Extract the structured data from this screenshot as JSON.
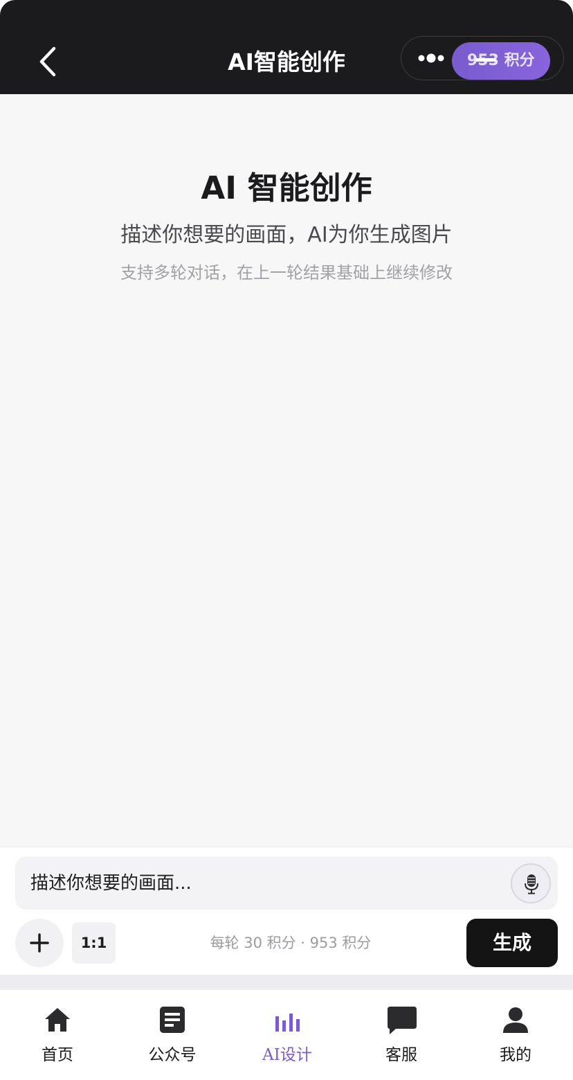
{
  "header": {
    "title": "AI智能创作",
    "credits_badge": "953 积分"
  },
  "hero": {
    "title": "AI 智能创作",
    "subtitle": "描述你想要的画面，AI为你生成图片",
    "hint": "支持多轮对话，在上一轮结果基础上继续修改"
  },
  "composer": {
    "placeholder": "描述你想要的画面...",
    "ratio_label": "1:1",
    "cost_info": "每轮 30 积分 · 953 积分",
    "generate_label": "生成"
  },
  "tabbar": {
    "items": [
      {
        "label": "首页",
        "icon": "home-icon"
      },
      {
        "label": "公众号",
        "icon": "article-icon"
      },
      {
        "label": "AI设计",
        "icon": "bar-chart-icon",
        "active": true
      },
      {
        "label": "客服",
        "icon": "chat-icon"
      },
      {
        "label": "我的",
        "icon": "person-icon"
      }
    ]
  },
  "colors": {
    "accent": "#7a5ccf",
    "topbar": "#1b1a1c",
    "background": "#f7f7f8",
    "primary_button": "#141414"
  }
}
